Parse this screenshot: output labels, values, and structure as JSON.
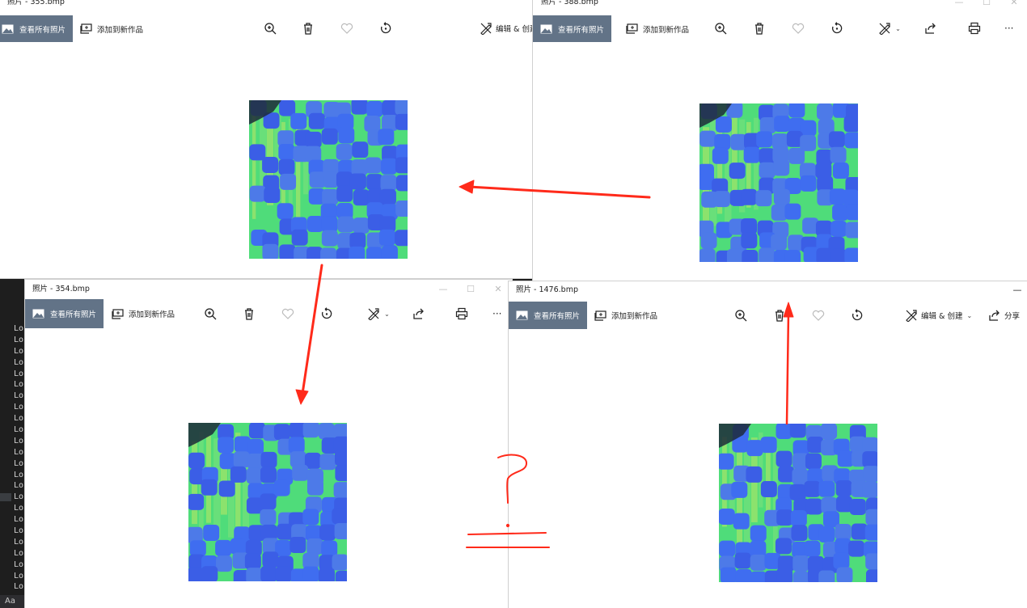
{
  "editor": {
    "lines": [
      "Lo",
      "Lo",
      "Lo",
      "Lo",
      "Lo",
      "Lo",
      "Lo",
      "Lo",
      "Lo",
      "Lo",
      "Lo",
      "Lo",
      "Lo",
      "Lo",
      "Lo",
      "Lo",
      "Lo",
      "Lo",
      "Lo",
      "Lo",
      "Lo",
      "Lo",
      "Lo",
      "Lo"
    ],
    "status": "Aa"
  },
  "windows": {
    "w355": {
      "title": "照片 - 355.bmp",
      "view_all": "查看所有照片",
      "add_to": "添加到新作品",
      "edit_create": "编辑 & 创建"
    },
    "w388": {
      "title": "照片 - 388.bmp",
      "view_all": "查看所有照片",
      "add_to": "添加到新作品",
      "more": "···"
    },
    "w354": {
      "title": "照片 - 354.bmp",
      "view_all": "查看所有照片",
      "add_to": "添加到新作品",
      "more": "···"
    },
    "w1476": {
      "title": "照片 - 1476.bmp",
      "view_all": "查看所有照片",
      "add_to": "添加到新作品",
      "edit_create": "编辑 & 创建",
      "share": "分享"
    }
  },
  "window_controls": {
    "minimize": "—",
    "maximize": "☐",
    "close": "✕"
  },
  "annotation": {
    "question_mark": "?"
  },
  "colors": {
    "accent_button": "#627387",
    "annotation_red": "#ff2a1a",
    "texture_blue": "#3b5ee6",
    "texture_green": "#4fdc7a"
  }
}
